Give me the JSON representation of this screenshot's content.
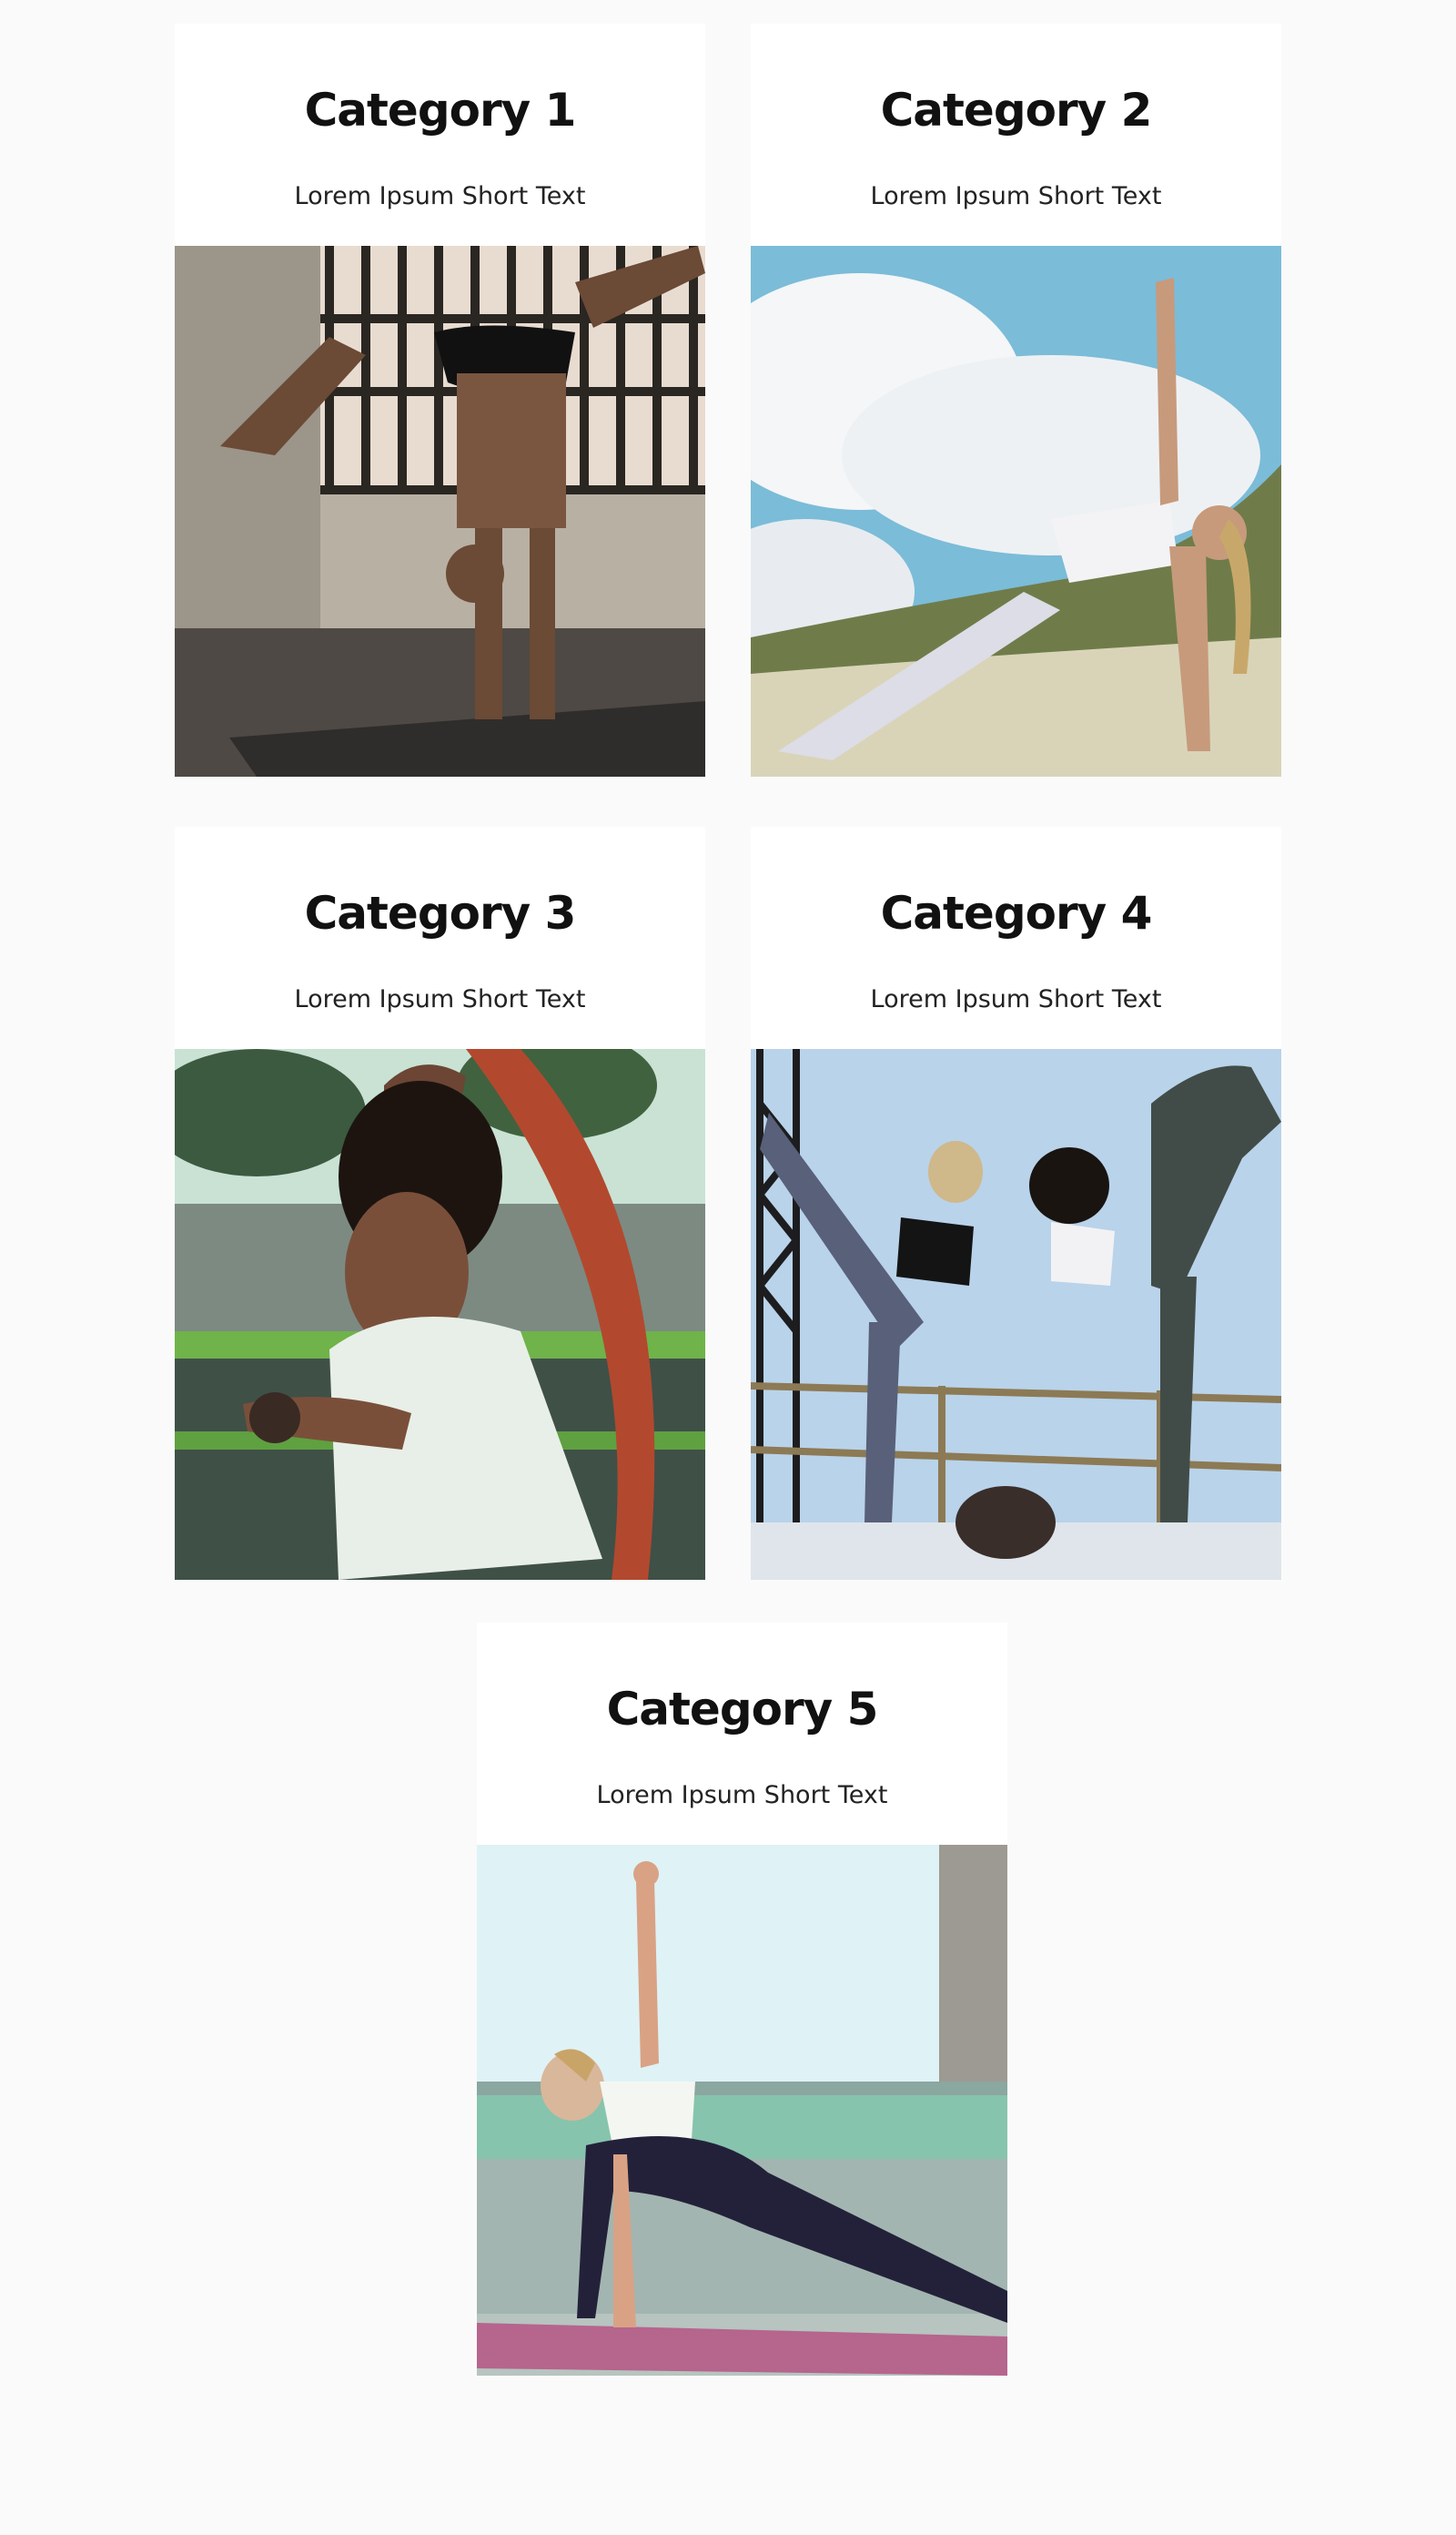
{
  "categories": [
    {
      "title": "Category 1",
      "text": "Lorem Ipsum Short Text"
    },
    {
      "title": "Category 2",
      "text": "Lorem Ipsum Short Text"
    },
    {
      "title": "Category 3",
      "text": "Lorem Ipsum Short Text"
    },
    {
      "title": "Category 4",
      "text": "Lorem Ipsum Short Text"
    },
    {
      "title": "Category 5",
      "text": "Lorem Ipsum Short Text"
    }
  ],
  "colors": {
    "page_background": "#fafafa",
    "card_background": "#ffffff",
    "title": "#111111",
    "text": "#222222"
  }
}
